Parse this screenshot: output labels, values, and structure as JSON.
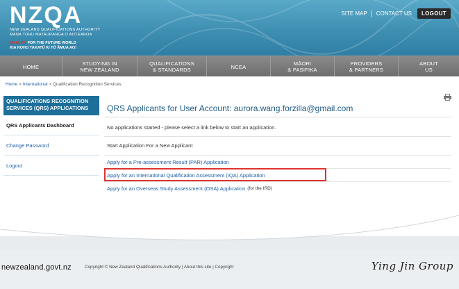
{
  "header": {
    "logo_text": "NZQA",
    "logo_sub1": "NEW ZEALAND QUALIFICATIONS AUTHORITY",
    "logo_sub2": "MANA TOHU MATAURANGA O AOTEAROA",
    "tag_red": "QUALIFY",
    "tag_rest": " FOR THE FUTURE WORLD",
    "tag2": "KIA NOHO TAKATŪ KI TŌ ĀMUA AO!",
    "site_map": "SITE MAP",
    "contact_us": "CONTACT US",
    "logout": "LOGOUT"
  },
  "nav": {
    "items": [
      {
        "l1": "HOME",
        "l2": ""
      },
      {
        "l1": "STUDYING IN",
        "l2": "NEW ZEALAND"
      },
      {
        "l1": "QUALIFICATIONS",
        "l2": "& STANDARDS"
      },
      {
        "l1": "NCEA",
        "l2": ""
      },
      {
        "l1": "MĀORI",
        "l2": "& PASIFIKA"
      },
      {
        "l1": "PROVIDERS",
        "l2": "& PARTNERS"
      },
      {
        "l1": "ABOUT",
        "l2": "US"
      }
    ]
  },
  "breadcrumb": {
    "home": "Home",
    "sep1": " > ",
    "international": "International",
    "sep2": " > ",
    "current": "Qualification Recognition Services"
  },
  "sidebar": {
    "heading": "QUALIFICATIONS RECOGNITION SERVICES (QRS) APPLICATIONS",
    "items": [
      {
        "label": "QRS Applicants Dashboard"
      },
      {
        "label": "Change Password"
      },
      {
        "label": "Logout"
      }
    ]
  },
  "main": {
    "title": "QRS Applicants for User Account: aurora.wang.forzilla@gmail.com",
    "no_apps": "No applications started - please select a link below to start an application.",
    "section_label": "Start Application For a New Applicant",
    "links": [
      {
        "label": "Apply for a Pre-assessment Result (PAR) Application",
        "note": ""
      },
      {
        "label": "Apply for an International Qualification Assessment (IQA) Application",
        "note": ""
      },
      {
        "label": "Apply for an Overseas Study Assessment (OSA) Application",
        "note": "(for the IRD)"
      }
    ]
  },
  "footer": {
    "govt": "newzealand.govt.nz",
    "copyright": "Copyright © New Zealand Qualifications Authority | About this site | Copyright",
    "watermark": "Ying Jin Group"
  },
  "colors": {
    "header_blue": "#3f8fb3",
    "nav_grey": "#7a7a7a",
    "sidebar_head": "#1d6f9a",
    "link_blue": "#1f5fa8",
    "highlight_red": "#e0322f"
  }
}
